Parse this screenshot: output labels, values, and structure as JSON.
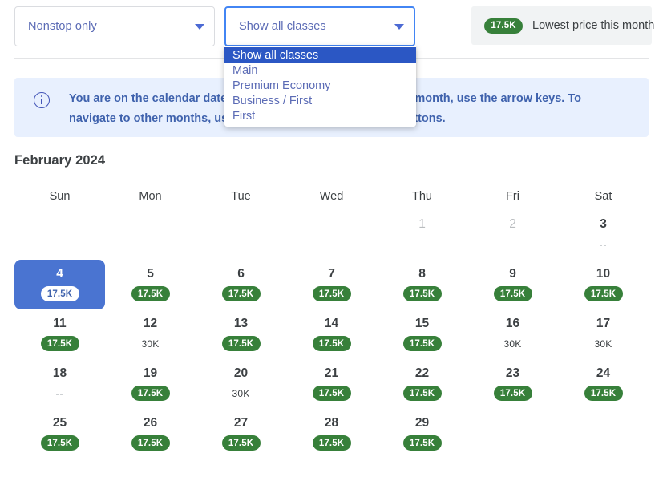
{
  "filters": {
    "stops_select": {
      "value": "Nonstop only",
      "caret_icon": "chevron-down-icon"
    },
    "class_select": {
      "value": "Show all classes",
      "caret_icon": "chevron-down-icon",
      "expanded": true,
      "options": [
        "Show all classes",
        "Main",
        "Premium Economy",
        "Business / First",
        "First"
      ],
      "selected_option": "Show all classes"
    }
  },
  "legend": {
    "badge": "17.5K",
    "label": "Lowest price this month",
    "badge_color": "#37803a",
    "background": "#f1f3f4"
  },
  "info_banner": {
    "icon": "info-circle-icon",
    "text": "You are on the calendar date picker. To navigate in the current month, use the arrow keys. To navigate to other months, use the next and previous month buttons.",
    "background": "#e8f0fe",
    "text_color": "#3f62ad"
  },
  "calendar": {
    "month_title": "February 2024",
    "weekdays": [
      "Sun",
      "Mon",
      "Tue",
      "Wed",
      "Thu",
      "Fri",
      "Sat"
    ],
    "selected_date": 4,
    "accent_color": "#4a74d1",
    "cells": [
      {
        "day": "",
        "price": "",
        "kind": "empty"
      },
      {
        "day": "",
        "price": "",
        "kind": "empty"
      },
      {
        "day": "",
        "price": "",
        "kind": "empty"
      },
      {
        "day": "",
        "price": "",
        "kind": "empty"
      },
      {
        "day": "1",
        "price": "",
        "kind": "muted"
      },
      {
        "day": "2",
        "price": "",
        "kind": "muted"
      },
      {
        "day": "3",
        "price": "--",
        "kind": "dash"
      },
      {
        "day": "4",
        "price": "17.5K",
        "kind": "selected"
      },
      {
        "day": "5",
        "price": "17.5K",
        "kind": "pill"
      },
      {
        "day": "6",
        "price": "17.5K",
        "kind": "pill"
      },
      {
        "day": "7",
        "price": "17.5K",
        "kind": "pill"
      },
      {
        "day": "8",
        "price": "17.5K",
        "kind": "pill"
      },
      {
        "day": "9",
        "price": "17.5K",
        "kind": "pill"
      },
      {
        "day": "10",
        "price": "17.5K",
        "kind": "pill"
      },
      {
        "day": "11",
        "price": "17.5K",
        "kind": "pill"
      },
      {
        "day": "12",
        "price": "30K",
        "kind": "plain"
      },
      {
        "day": "13",
        "price": "17.5K",
        "kind": "pill"
      },
      {
        "day": "14",
        "price": "17.5K",
        "kind": "pill"
      },
      {
        "day": "15",
        "price": "17.5K",
        "kind": "pill"
      },
      {
        "day": "16",
        "price": "30K",
        "kind": "plain"
      },
      {
        "day": "17",
        "price": "30K",
        "kind": "plain"
      },
      {
        "day": "18",
        "price": "--",
        "kind": "dash"
      },
      {
        "day": "19",
        "price": "17.5K",
        "kind": "pill"
      },
      {
        "day": "20",
        "price": "30K",
        "kind": "plain"
      },
      {
        "day": "21",
        "price": "17.5K",
        "kind": "pill"
      },
      {
        "day": "22",
        "price": "17.5K",
        "kind": "pill"
      },
      {
        "day": "23",
        "price": "17.5K",
        "kind": "pill"
      },
      {
        "day": "24",
        "price": "17.5K",
        "kind": "pill"
      },
      {
        "day": "25",
        "price": "17.5K",
        "kind": "pill"
      },
      {
        "day": "26",
        "price": "17.5K",
        "kind": "pill"
      },
      {
        "day": "27",
        "price": "17.5K",
        "kind": "pill"
      },
      {
        "day": "28",
        "price": "17.5K",
        "kind": "pill"
      },
      {
        "day": "29",
        "price": "17.5K",
        "kind": "pill"
      },
      {
        "day": "",
        "price": "",
        "kind": "empty"
      },
      {
        "day": "",
        "price": "",
        "kind": "empty"
      }
    ]
  }
}
